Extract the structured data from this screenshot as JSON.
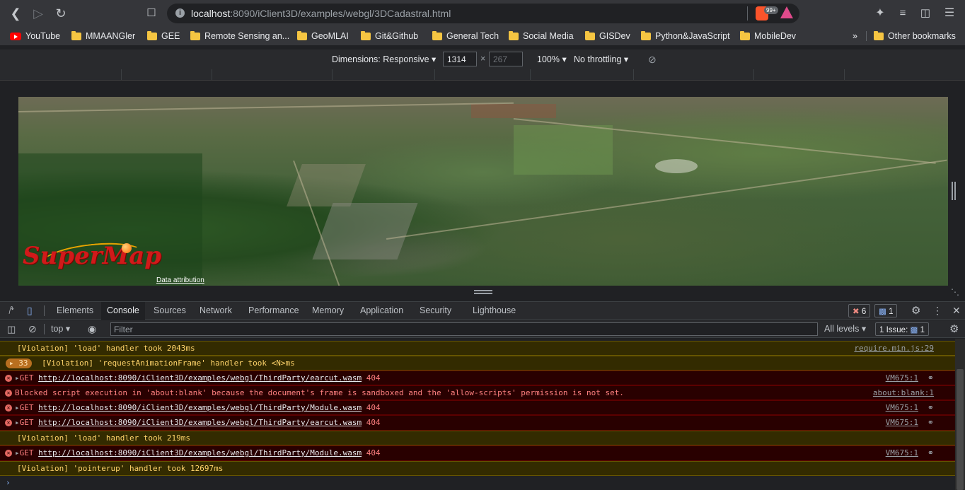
{
  "browser": {
    "url_host": "localhost",
    "url_path": ":8090/iClient3D/examples/webgl/3DCadastral.html",
    "ext_badge": "99+",
    "bookmarks": [
      {
        "label": "YouTube",
        "icon": "youtube-icon"
      },
      {
        "label": "MMAANGler",
        "icon": "folder-icon"
      },
      {
        "label": "GEE",
        "icon": "folder-icon"
      },
      {
        "label": "Remote Sensing an...",
        "icon": "folder-icon"
      },
      {
        "label": "GeoMLAI",
        "icon": "folder-icon"
      },
      {
        "label": "Git&Github",
        "icon": "folder-icon"
      },
      {
        "label": "General Tech",
        "icon": "folder-icon"
      },
      {
        "label": "Social Media",
        "icon": "folder-icon"
      },
      {
        "label": "GISDev",
        "icon": "folder-icon"
      },
      {
        "label": "Python&JavaScript",
        "icon": "folder-icon"
      },
      {
        "label": "MobileDev",
        "icon": "folder-icon"
      }
    ],
    "overflow": "»",
    "other_bookmarks": "Other bookmarks"
  },
  "device_toolbar": {
    "dimensions": "Dimensions: Responsive",
    "width": "1314",
    "height": "267",
    "times": "×",
    "zoom": "100%",
    "throttle": "No throttling"
  },
  "viewport": {
    "logo": "SuperMap",
    "attribution": "Data attribution"
  },
  "devtools": {
    "tabs": [
      "Elements",
      "Console",
      "Sources",
      "Network",
      "Performance",
      "Memory",
      "Application",
      "Security",
      "Lighthouse"
    ],
    "active_tab": "Console",
    "error_count": "6",
    "message_count": "1",
    "context": "top",
    "filter_placeholder": "Filter",
    "levels": "All levels",
    "issues": "1 Issue:",
    "issues_count": "1"
  },
  "console": {
    "messages": [
      {
        "type": "warn",
        "text": "[Violation] 'load' handler took 2043ms",
        "source": "require.min.js:29"
      },
      {
        "type": "warn",
        "count": "33",
        "text": "[Violation] 'requestAnimationFrame' handler took <N>ms",
        "source": ""
      },
      {
        "type": "err",
        "method": "GET",
        "url": "http://localhost:8090/iClient3D/examples/webgl/ThirdParty/earcut.wasm",
        "code": "404",
        "source": "VM675:1"
      },
      {
        "type": "err",
        "text": "Blocked script execution in 'about:blank' because the document's frame is sandboxed and the 'allow-scripts' permission is not set.",
        "source": "about:blank:1"
      },
      {
        "type": "err",
        "method": "GET",
        "url": "http://localhost:8090/iClient3D/examples/webgl/ThirdParty/Module.wasm",
        "code": "404",
        "source": "VM675:1"
      },
      {
        "type": "err",
        "method": "GET",
        "url": "http://localhost:8090/iClient3D/examples/webgl/ThirdParty/earcut.wasm",
        "code": "404",
        "source": "VM675:1"
      },
      {
        "type": "warn",
        "text": "[Violation] 'load' handler took 219ms",
        "source": ""
      },
      {
        "type": "err",
        "method": "GET",
        "url": "http://localhost:8090/iClient3D/examples/webgl/ThirdParty/Module.wasm",
        "code": "404",
        "source": "VM675:1"
      },
      {
        "type": "warn",
        "text": "[Violation] 'pointerup' handler took 12697ms",
        "source": ""
      }
    ],
    "prompt": "›"
  }
}
